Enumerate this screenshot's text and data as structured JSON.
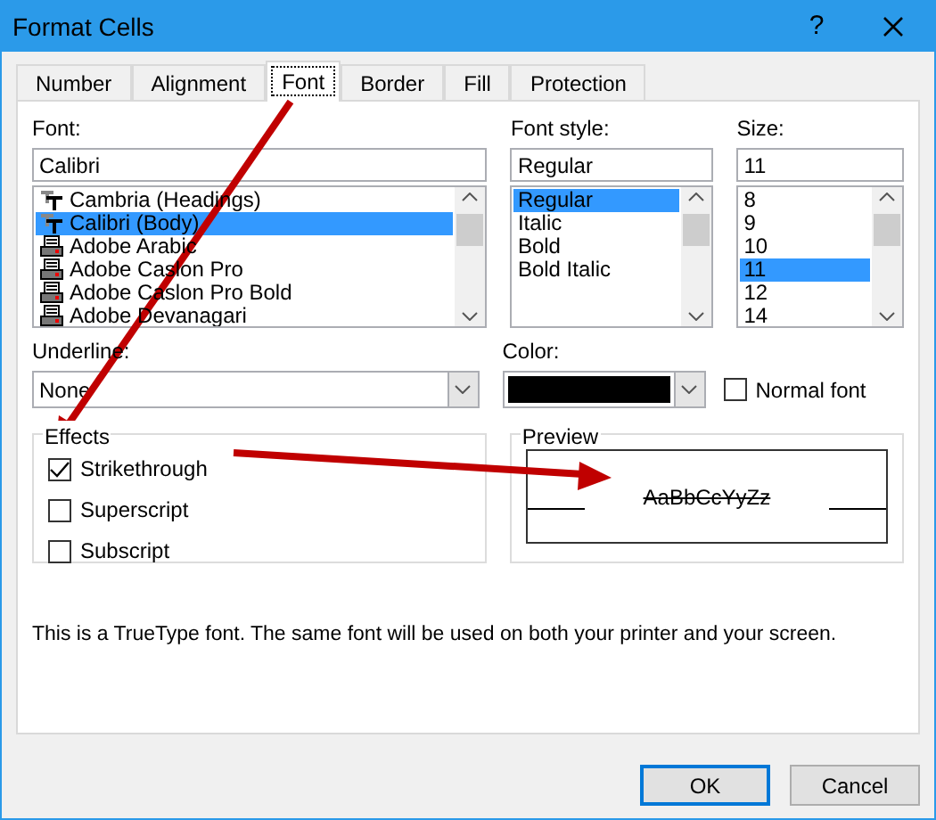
{
  "window": {
    "title": "Format Cells",
    "help": "?"
  },
  "tabs": [
    {
      "label": "Number",
      "selected": false
    },
    {
      "label": "Alignment",
      "selected": false
    },
    {
      "label": "Font",
      "selected": true
    },
    {
      "label": "Border",
      "selected": false
    },
    {
      "label": "Fill",
      "selected": false
    },
    {
      "label": "Protection",
      "selected": false
    }
  ],
  "font": {
    "label": "Font:",
    "value": "Calibri",
    "items": [
      {
        "label": "Cambria (Headings)",
        "kind": "truetype",
        "selected": false
      },
      {
        "label": "Calibri (Body)",
        "kind": "truetype",
        "selected": true
      },
      {
        "label": "Adobe Arabic",
        "kind": "printer",
        "selected": false
      },
      {
        "label": "Adobe Caslon Pro",
        "kind": "printer",
        "selected": false
      },
      {
        "label": "Adobe Caslon Pro Bold",
        "kind": "printer",
        "selected": false
      },
      {
        "label": "Adobe Devanagari",
        "kind": "printer",
        "selected": false
      }
    ]
  },
  "font_style": {
    "label": "Font style:",
    "value": "Regular",
    "items": [
      {
        "label": "Regular",
        "selected": true
      },
      {
        "label": "Italic",
        "selected": false
      },
      {
        "label": "Bold",
        "selected": false
      },
      {
        "label": "Bold Italic",
        "selected": false
      }
    ]
  },
  "size": {
    "label": "Size:",
    "value": "11",
    "items": [
      {
        "label": "8",
        "selected": false
      },
      {
        "label": "9",
        "selected": false
      },
      {
        "label": "10",
        "selected": false
      },
      {
        "label": "11",
        "selected": true
      },
      {
        "label": "12",
        "selected": false
      },
      {
        "label": "14",
        "selected": false
      }
    ]
  },
  "underline": {
    "label": "Underline:",
    "value": "None"
  },
  "color": {
    "label": "Color:",
    "color": "#000000"
  },
  "normal_font": {
    "label": "Normal font",
    "checked": false
  },
  "effects": {
    "title": "Effects",
    "items": [
      {
        "label": "Strikethrough",
        "checked": true
      },
      {
        "label": "Superscript",
        "checked": false
      },
      {
        "label": "Subscript",
        "checked": false
      }
    ]
  },
  "preview": {
    "title": "Preview",
    "sample": "AaBbCcYyZz"
  },
  "info": "This is a TrueType font.  The same font will be used on both your printer and your screen.",
  "buttons": [
    {
      "label": "OK",
      "default": true
    },
    {
      "label": "Cancel",
      "default": false
    }
  ]
}
